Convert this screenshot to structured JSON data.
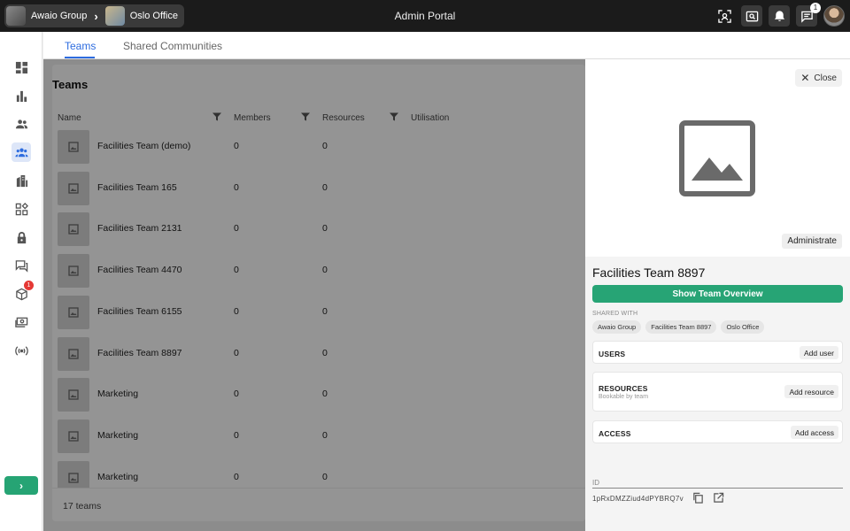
{
  "header": {
    "breadcrumb": [
      {
        "label": "Awaio Group"
      },
      {
        "label": "Oslo Office"
      }
    ],
    "title": "Admin Portal",
    "messages_badge": "1"
  },
  "sidebar": {
    "items": [
      {
        "icon": "dashboard-icon"
      },
      {
        "icon": "bar-chart-icon"
      },
      {
        "icon": "users-icon"
      },
      {
        "icon": "teams-icon",
        "active": true
      },
      {
        "icon": "buildings-icon"
      },
      {
        "icon": "widgets-icon"
      },
      {
        "icon": "lock-icon"
      },
      {
        "icon": "chat-icon"
      },
      {
        "icon": "package-icon",
        "badge": "1"
      },
      {
        "icon": "payments-icon"
      },
      {
        "icon": "broadcast-icon"
      }
    ],
    "expand_label": "›"
  },
  "tabs": [
    {
      "label": "Teams",
      "active": true
    },
    {
      "label": "Shared Communities",
      "active": false
    }
  ],
  "list": {
    "title": "Teams",
    "columns": [
      "Name",
      "Members",
      "Resources",
      "Utilisation"
    ],
    "rows": [
      {
        "name": "Facilities Team (demo)",
        "members": "0",
        "resources": "0"
      },
      {
        "name": "Facilities Team 165",
        "members": "0",
        "resources": "0"
      },
      {
        "name": "Facilities Team 2131",
        "members": "0",
        "resources": "0"
      },
      {
        "name": "Facilities Team 4470",
        "members": "0",
        "resources": "0"
      },
      {
        "name": "Facilities Team 6155",
        "members": "0",
        "resources": "0"
      },
      {
        "name": "Facilities Team 8897",
        "members": "0",
        "resources": "0"
      },
      {
        "name": "Marketing",
        "members": "0",
        "resources": "0"
      },
      {
        "name": "Marketing",
        "members": "0",
        "resources": "0"
      },
      {
        "name": "Marketing",
        "members": "0",
        "resources": "0"
      }
    ],
    "count_label": "17 teams"
  },
  "panel": {
    "close_label": "Close",
    "administrate_label": "Administrate",
    "team_name": "Facilities Team 8897",
    "overview_button": "Show Team Overview",
    "shared_with_label": "SHARED WITH",
    "shared_with": [
      "Awaio Group",
      "Facilities Team 8897",
      "Oslo Office"
    ],
    "sections": {
      "users": {
        "title": "USERS",
        "button": "Add user"
      },
      "resources": {
        "title": "RESOURCES",
        "subtitle": "Bookable by team",
        "button": "Add resource"
      },
      "access": {
        "title": "ACCESS",
        "button": "Add access"
      }
    },
    "id_label": "ID",
    "id_value": "1pRxDMZZiud4dPYBRQ7v"
  },
  "colors": {
    "accent_green": "#27a475",
    "accent_blue": "#2d6cdf",
    "topbar": "#1b1b1b",
    "badge_red": "#e53935"
  }
}
